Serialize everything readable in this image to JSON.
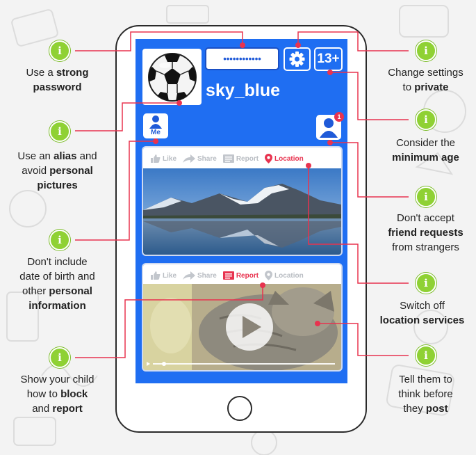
{
  "screen": {
    "password_mask": "••••••••••••",
    "age_label": "13+",
    "username": "sky_blue",
    "me_label": "Me",
    "friend_request_count": "1"
  },
  "posts": [
    {
      "actions": [
        {
          "label": "Like",
          "icon": "thumbs-up-icon",
          "active": false
        },
        {
          "label": "Share",
          "icon": "share-arrow-icon",
          "active": false
        },
        {
          "label": "Report",
          "icon": "report-flag-icon",
          "active": false
        },
        {
          "label": "Location",
          "icon": "location-pin-icon",
          "active": true
        }
      ],
      "media": "lake-mountain-photo"
    },
    {
      "actions": [
        {
          "label": "Like",
          "icon": "thumbs-up-icon",
          "active": false
        },
        {
          "label": "Share",
          "icon": "share-arrow-icon",
          "active": false
        },
        {
          "label": "Report",
          "icon": "report-flag-icon",
          "active": true
        },
        {
          "label": "Location",
          "icon": "location-pin-icon",
          "active": false
        }
      ],
      "media": "cat-video"
    }
  ],
  "tips": {
    "password": {
      "pre": "Use a ",
      "b1": "strong",
      "line2": "password"
    },
    "alias": {
      "pre": "Use an ",
      "b1": "alias",
      "mid": " and",
      "line2a": "avoid ",
      "b2": "personal",
      "line3": "pictures"
    },
    "birth": {
      "line1": "Don't include",
      "line2": "date of birth and",
      "line3a": "other ",
      "b1": "personal",
      "line4": "information"
    },
    "block": {
      "line1": "Show your child",
      "line2a": "how to ",
      "b1": "block",
      "line3a": "and ",
      "b2": "report"
    },
    "settings": {
      "line1": "Change settings",
      "line2a": "to ",
      "b1": "private"
    },
    "age": {
      "line1": "Consider the",
      "b1": "minimum age"
    },
    "friends": {
      "line1": "Don't accept",
      "b1": "friend requests",
      "line3": "from strangers"
    },
    "location": {
      "line1": "Switch off",
      "b1": "location services"
    },
    "post": {
      "line1": "Tell them to",
      "line2": "think before",
      "line3a": "they ",
      "b1": "post"
    }
  },
  "colors": {
    "screen_blue": "#1f6ef2",
    "connector_pink": "#e8334f",
    "info_green": "#8fd134",
    "active_red": "#e8334f"
  }
}
